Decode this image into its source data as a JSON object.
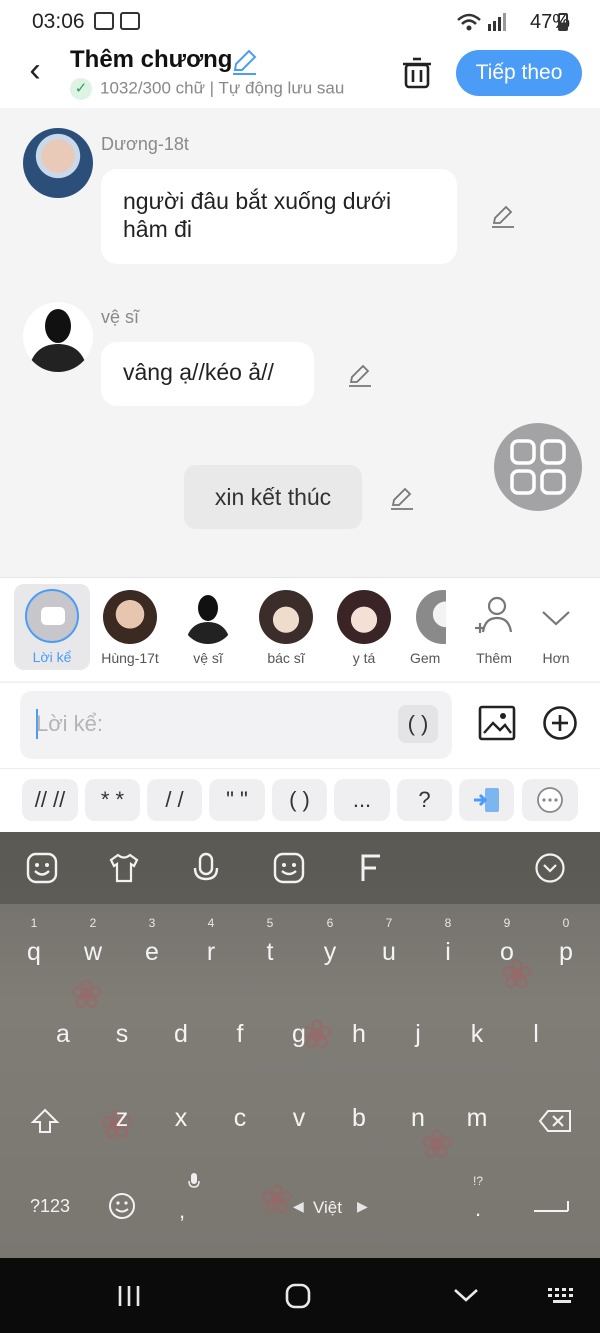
{
  "status_bar": {
    "time": "03:06",
    "battery": "47%"
  },
  "header": {
    "title": "Thêm chương",
    "subtitle": "1032/300 chữ | Tự động lưu sau",
    "next_label": "Tiếp theo",
    "accent": "#4b9cf6"
  },
  "messages": [
    {
      "sender": "Dương-18t",
      "text": "người đâu bắt xuống dưới hâm đi"
    },
    {
      "sender": "vệ sĩ",
      "text": "vâng ạ//kéo ả//"
    },
    {
      "sender": "",
      "text": "xin kết thúc"
    }
  ],
  "characters": [
    {
      "label": "Lời kể",
      "selected": true
    },
    {
      "label": "Hùng-17t"
    },
    {
      "label": "vệ sĩ"
    },
    {
      "label": "bác sĩ"
    },
    {
      "label": "y tá"
    },
    {
      "label": "Gem"
    },
    {
      "label": "Thêm"
    },
    {
      "label": "Hơn"
    }
  ],
  "input": {
    "placeholder": "Lời kể:",
    "paren_label": "( )"
  },
  "format_buttons": [
    "// //",
    "* *",
    "/ /",
    "\" \"",
    "( )",
    "...",
    "?"
  ],
  "keyboard": {
    "number_hints": [
      "1",
      "2",
      "3",
      "4",
      "5",
      "6",
      "7",
      "8",
      "9",
      "0"
    ],
    "row1": [
      "q",
      "w",
      "e",
      "r",
      "t",
      "y",
      "u",
      "i",
      "o",
      "p"
    ],
    "row2": [
      "a",
      "s",
      "d",
      "f",
      "g",
      "h",
      "j",
      "k",
      "l"
    ],
    "row3": [
      "z",
      "x",
      "c",
      "v",
      "b",
      "n",
      "m"
    ],
    "symbols_label": "?123",
    "language_label": "Việt",
    "comma": ",",
    "period": ".",
    "punct_hint": "!?"
  }
}
